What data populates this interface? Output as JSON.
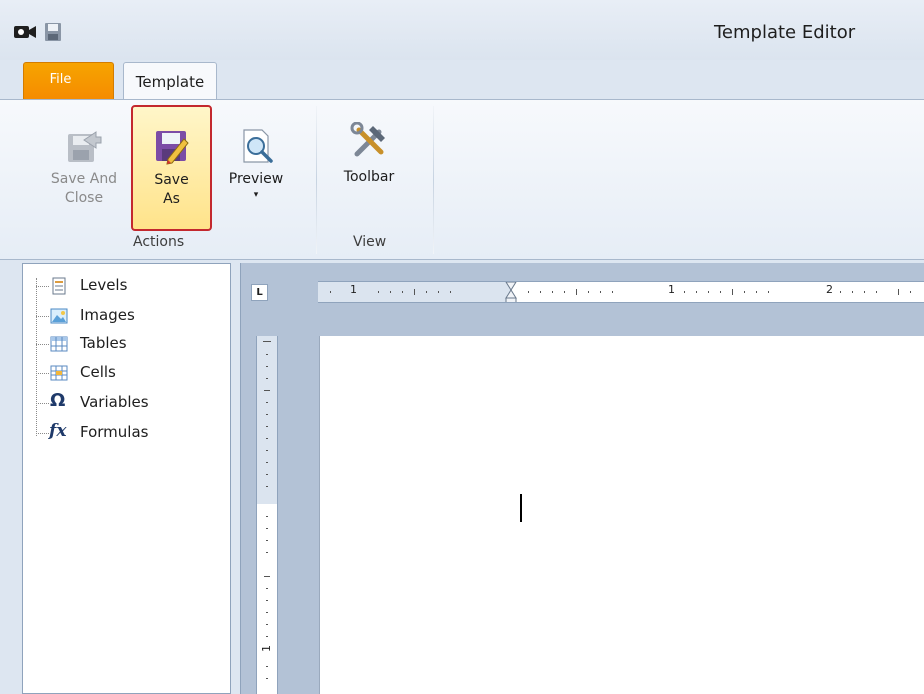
{
  "window": {
    "title": "Template Editor"
  },
  "quick_access": {
    "app_icon": "camera-app-icon",
    "save_icon": "floppy-disk-icon"
  },
  "tabs": [
    {
      "label": "File",
      "active": false
    },
    {
      "label": "Template",
      "active": true
    }
  ],
  "ribbon": {
    "groups": [
      {
        "label": "Actions",
        "buttons": [
          {
            "label_line1": "Save And",
            "label_line2": "Close",
            "icon": "save-and-close-icon",
            "enabled": false
          },
          {
            "label_line1": "Save",
            "label_line2": "As",
            "icon": "save-as-icon",
            "enabled": true,
            "highlighted": true
          },
          {
            "label_line1": "Preview",
            "label_line2": "▾",
            "icon": "preview-icon",
            "enabled": true,
            "has_dropdown": true
          }
        ]
      },
      {
        "label": "View",
        "buttons": [
          {
            "label_line1": "Toolbar",
            "icon": "tools-icon",
            "enabled": true
          }
        ]
      }
    ]
  },
  "tree": {
    "items": [
      {
        "label": "Levels",
        "icon": "levels-icon"
      },
      {
        "label": "Images",
        "icon": "image-icon"
      },
      {
        "label": "Tables",
        "icon": "table-icon"
      },
      {
        "label": "Cells",
        "icon": "cell-icon"
      },
      {
        "label": "Variables",
        "icon": "omega-icon"
      },
      {
        "label": "Formulas",
        "icon": "fx-icon"
      }
    ]
  },
  "editor": {
    "tab_stop_glyph": "L",
    "ruler_numbers": [
      "1",
      "1",
      "2"
    ],
    "vruler_number": "1"
  },
  "colors": {
    "file_tab": "#f58b00",
    "highlight_border": "#c3282e",
    "highlight_fill": "#ffe38a",
    "ribbon_bg": "#e6edf6",
    "workspace_bg": "#b3c2d6"
  }
}
